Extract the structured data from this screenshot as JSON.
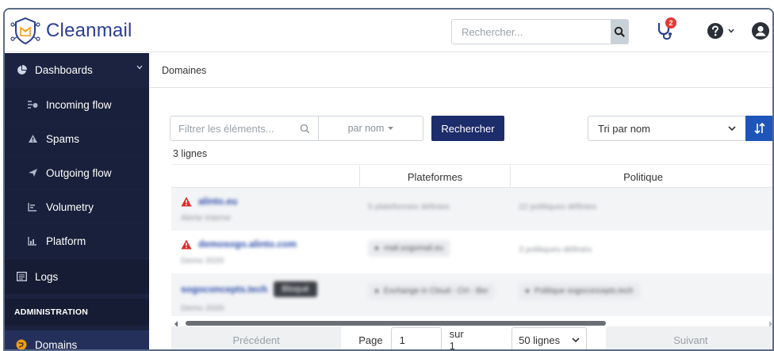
{
  "app": {
    "name": "Cleanmail"
  },
  "header": {
    "search_placeholder": "Rechercher...",
    "notification_count": "2"
  },
  "sidebar": {
    "dashboards": "Dashboards",
    "sub_items": [
      {
        "label": "Incoming flow",
        "icon": "incoming-flow-icon"
      },
      {
        "label": "Spams",
        "icon": "warning-icon"
      },
      {
        "label": "Outgoing flow",
        "icon": "send-icon"
      },
      {
        "label": "Volumetry",
        "icon": "list-icon"
      },
      {
        "label": "Platform",
        "icon": "chart-icon"
      }
    ],
    "logs": "Logs",
    "section_admin": "ADMINISTRATION",
    "domains": "Domains"
  },
  "breadcrumb": "Domaines",
  "filters": {
    "input_placeholder": "Filtrer les éléments...",
    "field_select": "par nom",
    "search_button": "Rechercher",
    "sort_select": "Tri par nom"
  },
  "row_count": "3 lignes",
  "table": {
    "columns": [
      "",
      "Plateformes",
      "Politique"
    ],
    "rows": [
      {
        "domain": "alinto.eu",
        "sub": "Alerte Interne",
        "platform": "5 plateformes définies",
        "policy": "22 politiques définies",
        "warn": true
      },
      {
        "domain": "demosogo.alinto.com",
        "sub": "Demo 2020",
        "platform": "mail.sogomail.eu",
        "policy": "3 politiques définies",
        "warn": true
      },
      {
        "domain": "sogoconcepts.tech",
        "badge": "Bloqué",
        "sub": "Demo 2020",
        "platform": "Exchange in Cloud - CH - Ber",
        "policy": "Politique sogoconcepts.tech",
        "warn": false
      }
    ]
  },
  "pager": {
    "prev": "Précédent",
    "page_label": "Page",
    "page_value": "1",
    "of_label": "sur 1",
    "per_page": "50 lignes",
    "next": "Suivant"
  }
}
